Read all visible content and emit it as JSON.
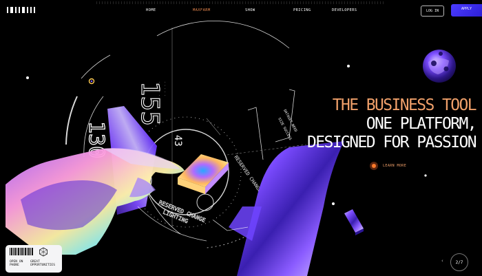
{
  "nav": {
    "items": [
      {
        "label": "HOME"
      },
      {
        "label": "MAXFARM",
        "active": true
      },
      {
        "label": "SHOW"
      },
      {
        "label": "PRICING"
      },
      {
        "label": "DEVELOPERS"
      }
    ],
    "login_label": "LOG IN",
    "apply_label": "APPLY"
  },
  "hero": {
    "line1": "THE BUSINESS TOOL",
    "line2": "ONE PLATFORM,",
    "line3": "DESIGNED FOR PASSION",
    "learn_more": "LEARN MORE"
  },
  "hud": {
    "big_number": "155",
    "number_b": "130",
    "number_c": "43",
    "text_reserved": "RESERVED CHANGE",
    "text_reserved2": "RESERVED CHANGE",
    "text_lighting": "LIGHTING",
    "text_dataset": "DATASET NEED",
    "text_size": "SIZE SUCCESS"
  },
  "card": {
    "open_line1": "OPEN ON",
    "open_line2": "PHONE",
    "great_line1": "GREAT",
    "great_line2": "OPPORTUNITIES"
  },
  "pager": {
    "label": "2/7",
    "arrow": "‹"
  },
  "colors": {
    "accent_orange": "#f0a06a",
    "apply_blue": "#3b2ef0",
    "hologram_violet": "#7a4cff"
  }
}
